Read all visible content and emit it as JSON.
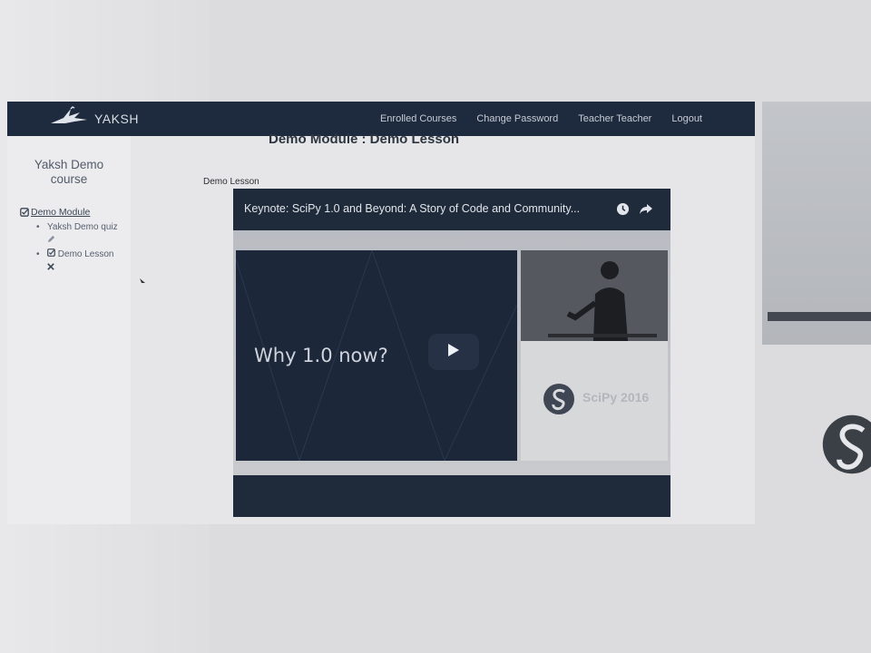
{
  "navbar": {
    "brand": "YAKSH",
    "links": [
      "Enrolled Courses",
      "Change Password",
      "Teacher Teacher",
      "Logout"
    ]
  },
  "sidebar": {
    "course_title": "Yaksh Demo course",
    "module": {
      "label": "Demo Module",
      "icon": "check-square-icon"
    },
    "lessons": [
      {
        "label": "Yaksh Demo quiz",
        "status_icon": "pencil-icon"
      },
      {
        "label": "Demo Lesson",
        "status_icon": "x-icon"
      }
    ]
  },
  "main": {
    "heading": "Demo Module : Demo Lesson",
    "lesson_label": "Demo Lesson"
  },
  "video": {
    "title": "Keynote: SciPy 1.0 and Beyond: A Story of Code and Community...",
    "slide_text": "Why 1.0 now?",
    "logo_text": "SciPy 2016",
    "controls": [
      "clock-icon",
      "share-icon",
      "play-icon"
    ]
  },
  "colors": {
    "navbar_bg": "#1e2a3d",
    "video_bg": "#1f2a3a",
    "page_bg": "#e6e6e8"
  }
}
